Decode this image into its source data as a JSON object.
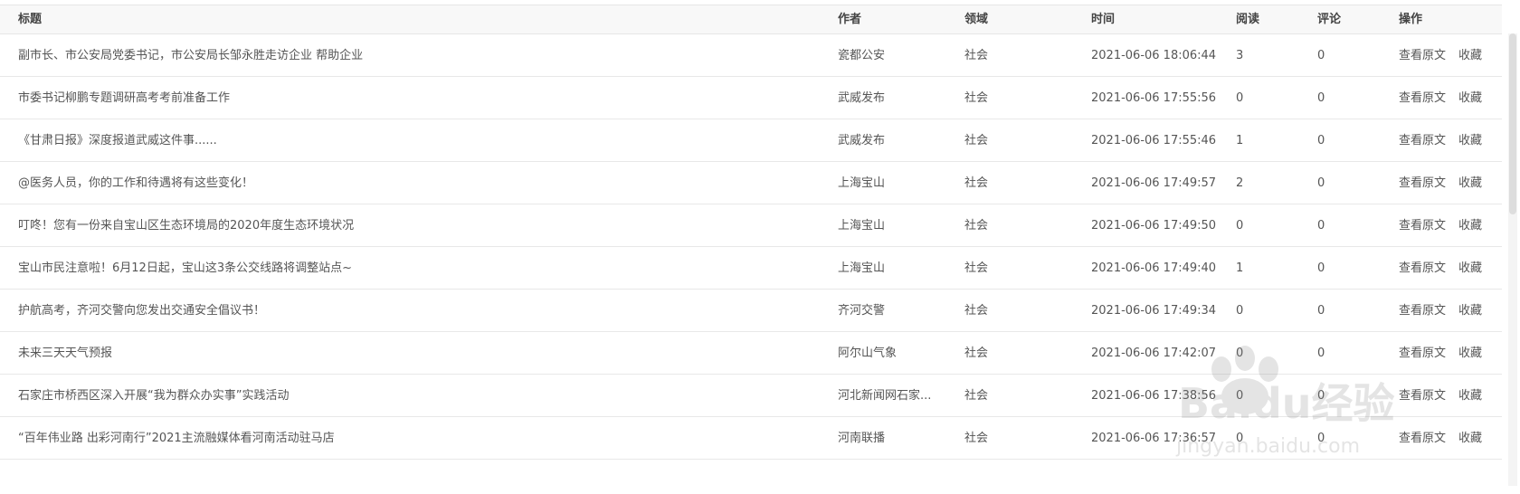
{
  "table": {
    "headers": {
      "title": "标题",
      "author": "作者",
      "domain": "领域",
      "time": "时间",
      "read": "阅读",
      "comment": "评论",
      "action": "操作"
    },
    "actions": {
      "view": "查看原文",
      "collect": "收藏"
    },
    "rows": [
      {
        "title": "副市长、市公安局党委书记，市公安局长邹永胜走访企业 帮助企业",
        "author": "瓷都公安",
        "domain": "社会",
        "time": "2021-06-06 18:06:44",
        "read": "3",
        "comment": "0"
      },
      {
        "title": "市委书记柳鹏专题调研高考考前准备工作",
        "author": "武威发布",
        "domain": "社会",
        "time": "2021-06-06 17:55:56",
        "read": "0",
        "comment": "0"
      },
      {
        "title": "《甘肃日报》深度报道武威这件事......",
        "author": "武威发布",
        "domain": "社会",
        "time": "2021-06-06 17:55:46",
        "read": "1",
        "comment": "0"
      },
      {
        "title": "@医务人员，你的工作和待遇将有这些变化！",
        "author": "上海宝山",
        "domain": "社会",
        "time": "2021-06-06 17:49:57",
        "read": "2",
        "comment": "0"
      },
      {
        "title": "叮咚！您有一份来自宝山区生态环境局的2020年度生态环境状况",
        "author": "上海宝山",
        "domain": "社会",
        "time": "2021-06-06 17:49:50",
        "read": "0",
        "comment": "0"
      },
      {
        "title": "宝山市民注意啦！6月12日起，宝山这3条公交线路将调整站点~",
        "author": "上海宝山",
        "domain": "社会",
        "time": "2021-06-06 17:49:40",
        "read": "1",
        "comment": "0"
      },
      {
        "title": "护航高考，齐河交警向您发出交通安全倡议书！",
        "author": "齐河交警",
        "domain": "社会",
        "time": "2021-06-06 17:49:34",
        "read": "0",
        "comment": "0"
      },
      {
        "title": "未来三天天气预报",
        "author": "阿尔山气象",
        "domain": "社会",
        "time": "2021-06-06 17:42:07",
        "read": "0",
        "comment": "0"
      },
      {
        "title": "石家庄市桥西区深入开展“我为群众办实事”实践活动",
        "author": "河北新闻网石家...",
        "domain": "社会",
        "time": "2021-06-06 17:38:56",
        "read": "0",
        "comment": "0"
      },
      {
        "title": "“百年伟业路 出彩河南行”2021主流融媒体看河南活动驻马店",
        "author": "河南联播",
        "domain": "社会",
        "time": "2021-06-06 17:36:57",
        "read": "0",
        "comment": "0"
      }
    ]
  },
  "watermark": {
    "brand": "Baidu经验",
    "url": "jingyan.baidu.com"
  }
}
